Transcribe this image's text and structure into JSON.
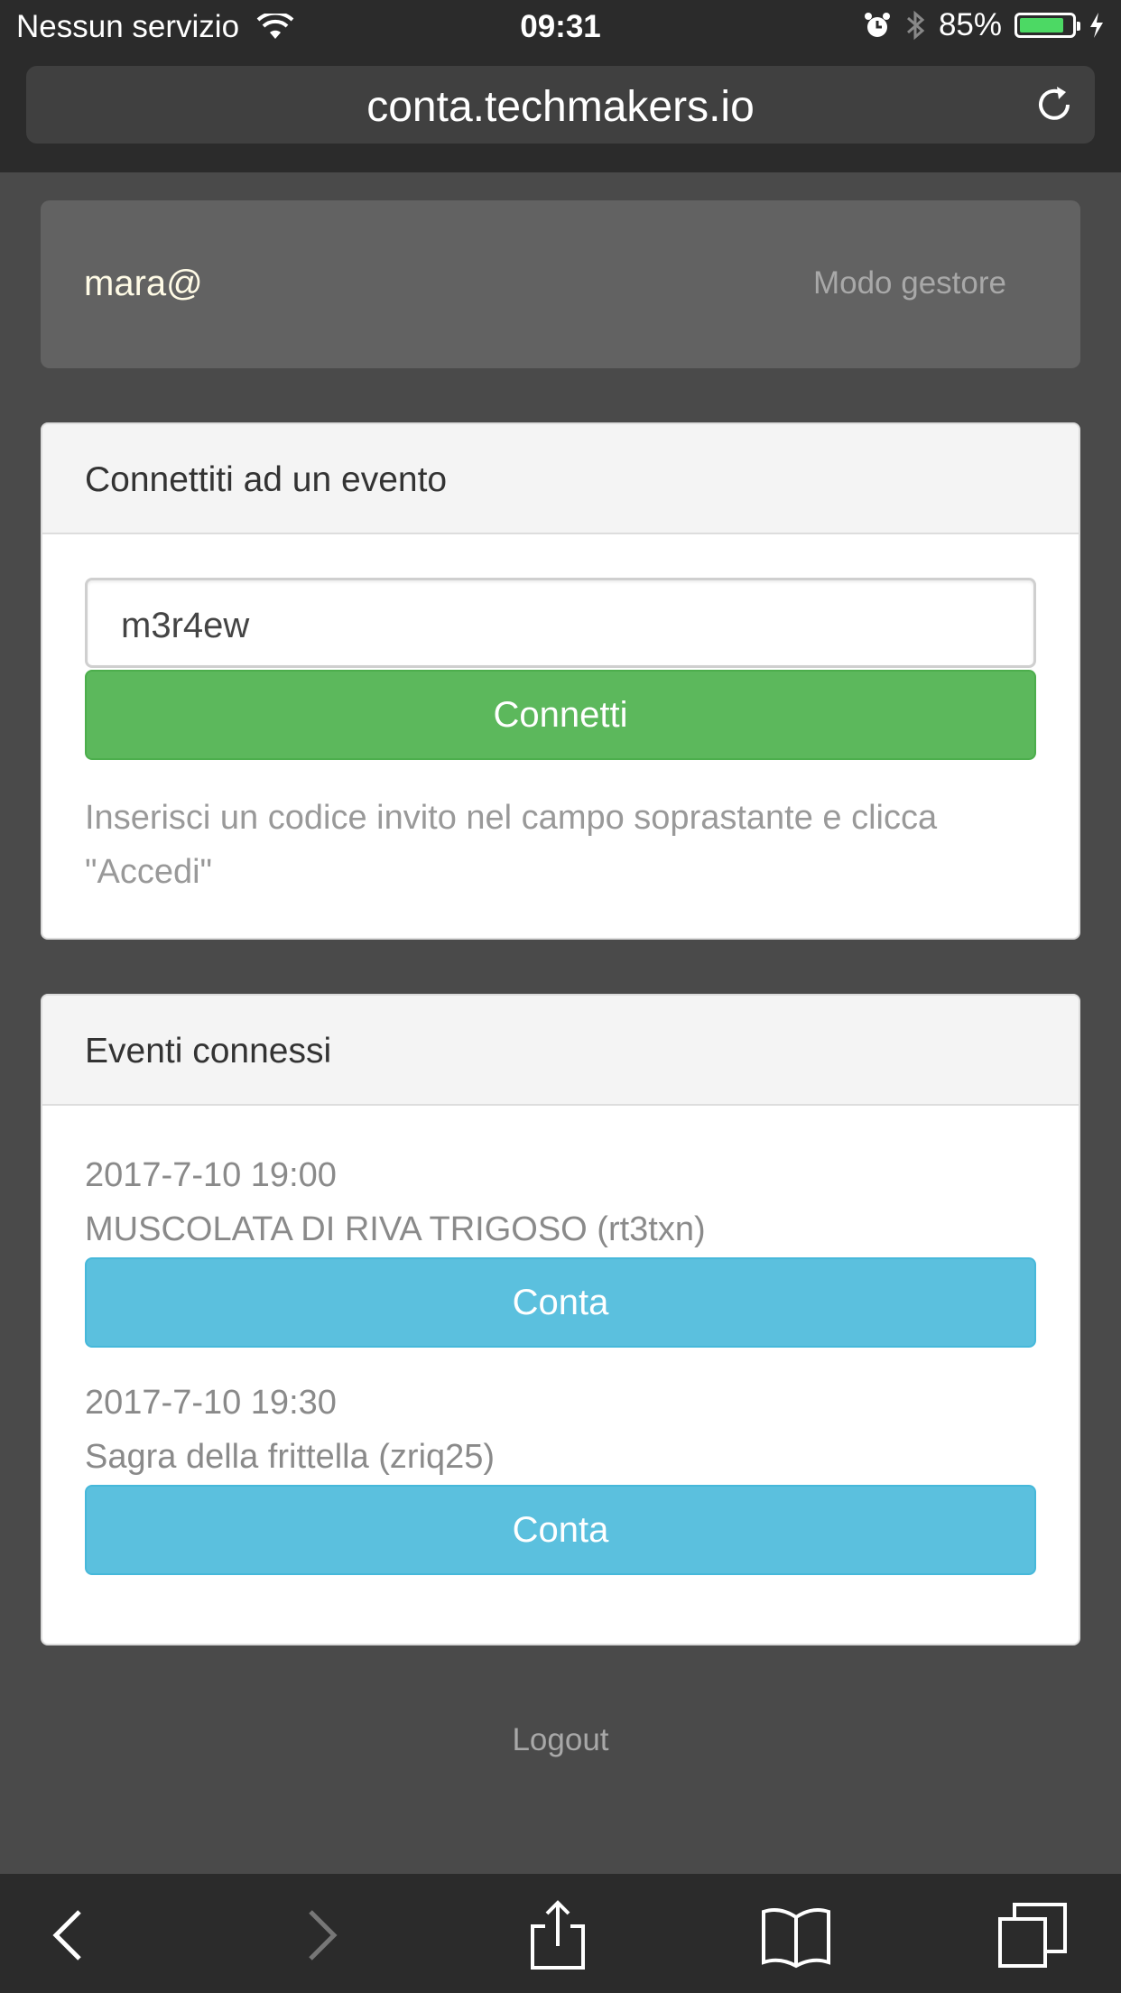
{
  "status_bar": {
    "carrier": "Nessun servizio",
    "time": "09:31",
    "battery": "85%",
    "battery_level": 0.85
  },
  "browser": {
    "url": "conta.techmakers.io"
  },
  "top_panel": {
    "user_email": "mara@",
    "manager_mode": "Modo gestore"
  },
  "connect_card": {
    "title": "Connettiti ad un evento",
    "code_value": "m3r4ew",
    "connect_label": "Connetti",
    "hint": "Inserisci un codice invito nel campo soprastante e clicca \"Accedi\""
  },
  "events_card": {
    "title": "Eventi connessi",
    "events": [
      {
        "date": "2017-7-10 19:00",
        "name": "MUSCOLATA DI RIVA TRIGOSO (rt3txn)",
        "button": "Conta"
      },
      {
        "date": "2017-7-10 19:30",
        "name": "Sagra della frittella (zriq25)",
        "button": "Conta"
      }
    ]
  },
  "logout_label": "Logout",
  "colors": {
    "success": "#5cb85c",
    "info": "#5bc0de",
    "background": "#4a4a4a"
  }
}
